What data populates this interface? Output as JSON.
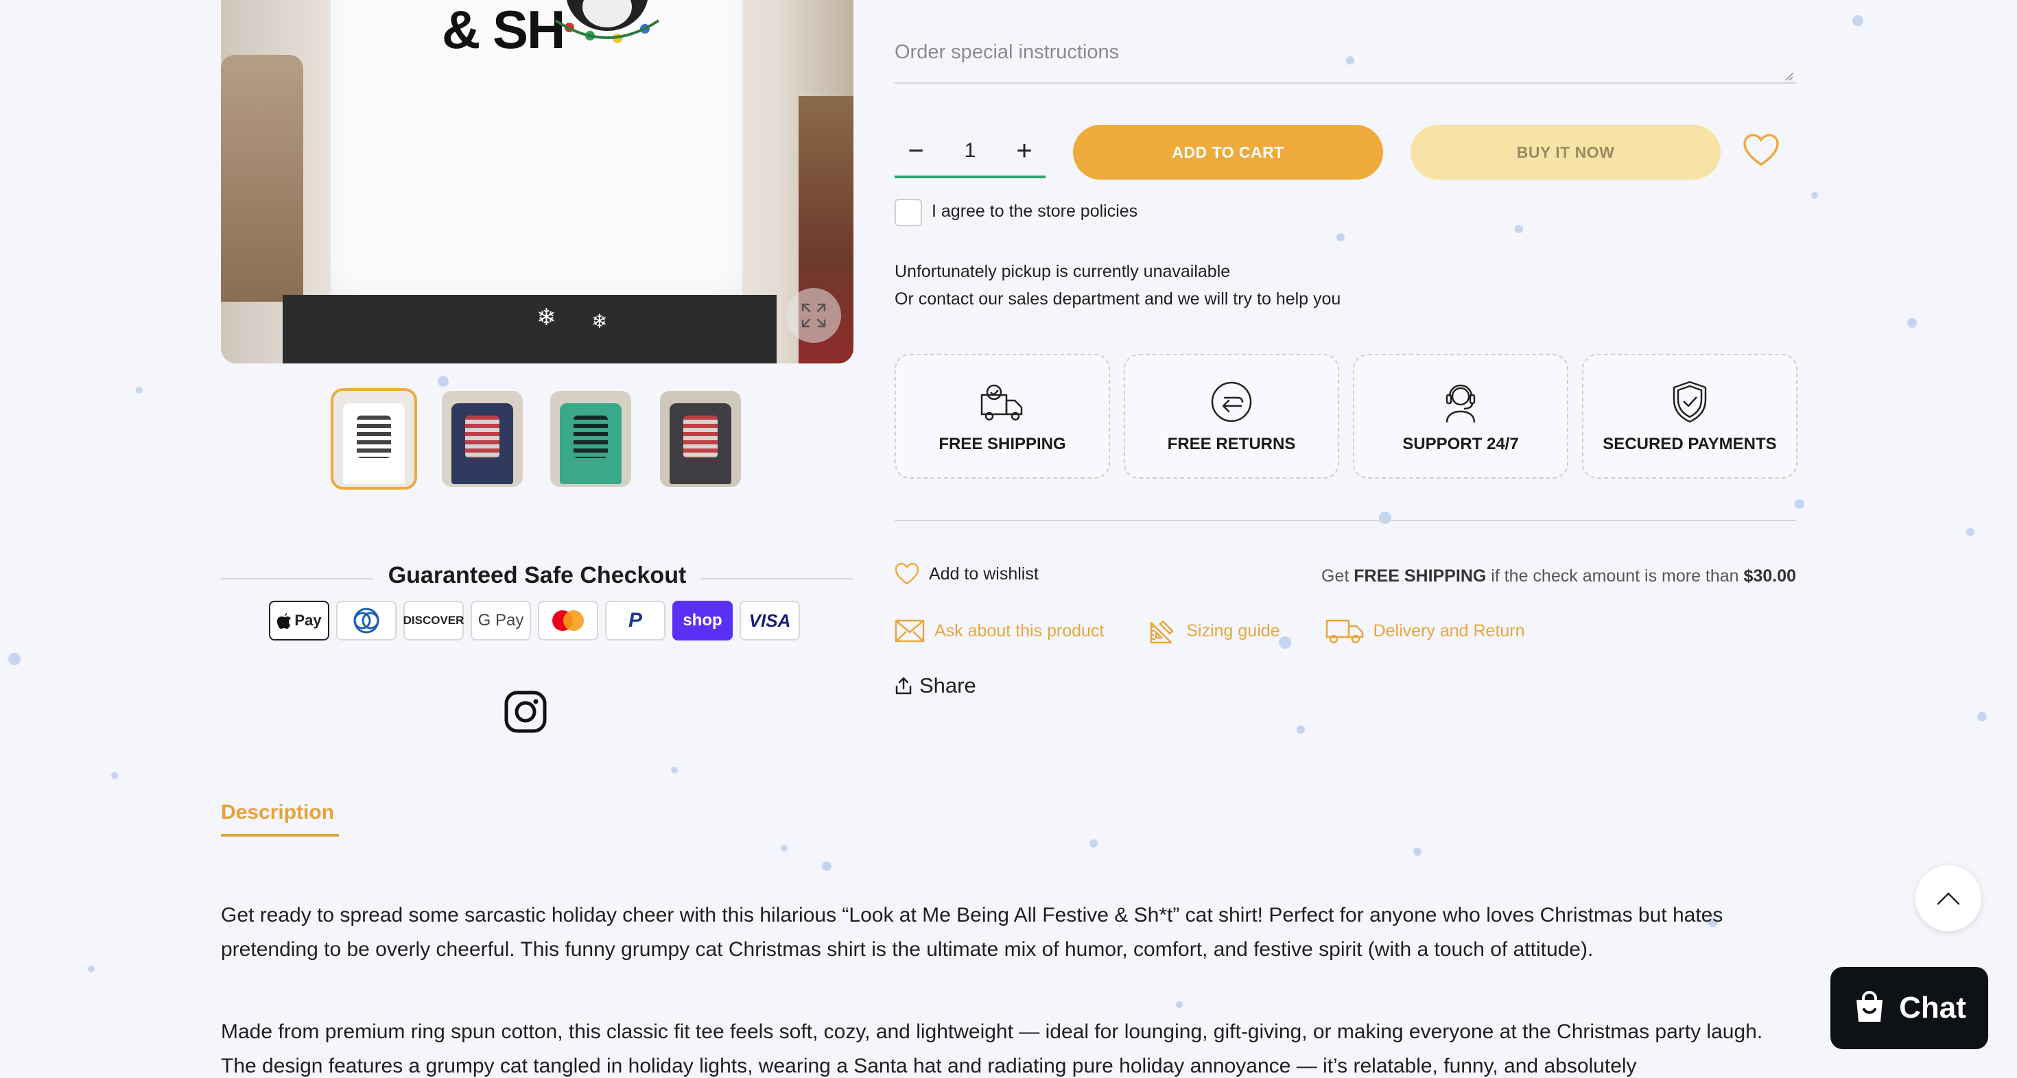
{
  "product": {
    "shirt_print": "& SH",
    "thumbnails": [
      {
        "color": "#ffffff"
      },
      {
        "color": "#2f3a5e"
      },
      {
        "color": "#3aa889"
      },
      {
        "color": "#3f3f43"
      }
    ]
  },
  "checkout": {
    "title": "Guaranteed Safe Checkout",
    "payments": [
      "Apple Pay",
      "Diners Club",
      "Discover",
      "Google Pay",
      "Mastercard",
      "PayPal",
      "Shop Pay",
      "Visa"
    ],
    "pay_labels": {
      "apple": "Pay",
      "discover": "DISCOVER",
      "gpay": "G Pay",
      "paypal": "P",
      "shop": "shop",
      "visa": "VISA"
    }
  },
  "form": {
    "instructions_placeholder": "Order special instructions",
    "quantity": "1",
    "minus": "−",
    "plus": "+",
    "add_to_cart": "ADD TO CART",
    "buy_now": "BUY IT NOW",
    "agree_label": "I agree to the store policies"
  },
  "pickup": {
    "line1": "Unfortunately pickup is currently unavailable",
    "line2": "Or contact our sales department and we will try to help you"
  },
  "features": [
    {
      "label": "FREE SHIPPING",
      "icon": "truck-icon"
    },
    {
      "label": "FREE RETURNS",
      "icon": "return-icon"
    },
    {
      "label": "SUPPORT 24/7",
      "icon": "support-icon"
    },
    {
      "label": "SECURED PAYMENTS",
      "icon": "shield-icon"
    }
  ],
  "wishlist": {
    "label": "Add to wishlist"
  },
  "free_shipping": {
    "prefix": "Get ",
    "strong": "FREE SHIPPING",
    "middle": " if the check amount is more than ",
    "amount": "$30.00"
  },
  "links": {
    "ask": "Ask about this product",
    "sizing": "Sizing guide",
    "delivery": "Delivery and Return"
  },
  "share": {
    "label": "Share"
  },
  "description": {
    "tab": "Description",
    "p1": "Get ready to spread some sarcastic holiday cheer with this hilarious “Look at Me Being All Festive & Sh*t” cat shirt! Perfect for anyone who loves Christmas but hates pretending to be overly cheerful. This funny grumpy cat Christmas shirt is the ultimate mix of humor, comfort, and festive spirit (with a touch of attitude).",
    "p2": "Made from premium ring spun cotton, this classic fit tee feels soft, cozy, and lightweight — ideal for lounging, gift-giving, or making everyone at the Christmas party laugh. The design features a grumpy cat tangled in holiday lights, wearing a Santa hat and radiating pure holiday annoyance — it’s relatable, funny, and absolutely"
  },
  "chat": {
    "label": "Chat"
  },
  "colors": {
    "accent": "#efaa3c",
    "buy_now_bg": "#f7e3a6",
    "link": "#e8a63c",
    "qty_underline": "#2fa36b",
    "chat_bg": "#0e1116"
  }
}
